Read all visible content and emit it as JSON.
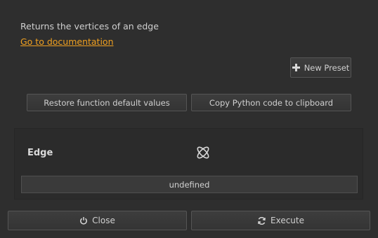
{
  "description": "Returns the vertices of an edge",
  "documentation_link": "Go to documentation",
  "toolbar": {
    "new_preset_label": "New Preset",
    "restore_label": "Restore function default values",
    "copy_label": "Copy Python code to clipboard"
  },
  "parameter": {
    "name": "Edge",
    "icon": "edge-selection-icon",
    "value": "undefined"
  },
  "footer": {
    "close_label": "Close",
    "execute_label": "Execute"
  },
  "colors": {
    "background": "#2e2e2e",
    "link": "#f0a020",
    "button": "#3a3a3a",
    "border": "#555555"
  }
}
